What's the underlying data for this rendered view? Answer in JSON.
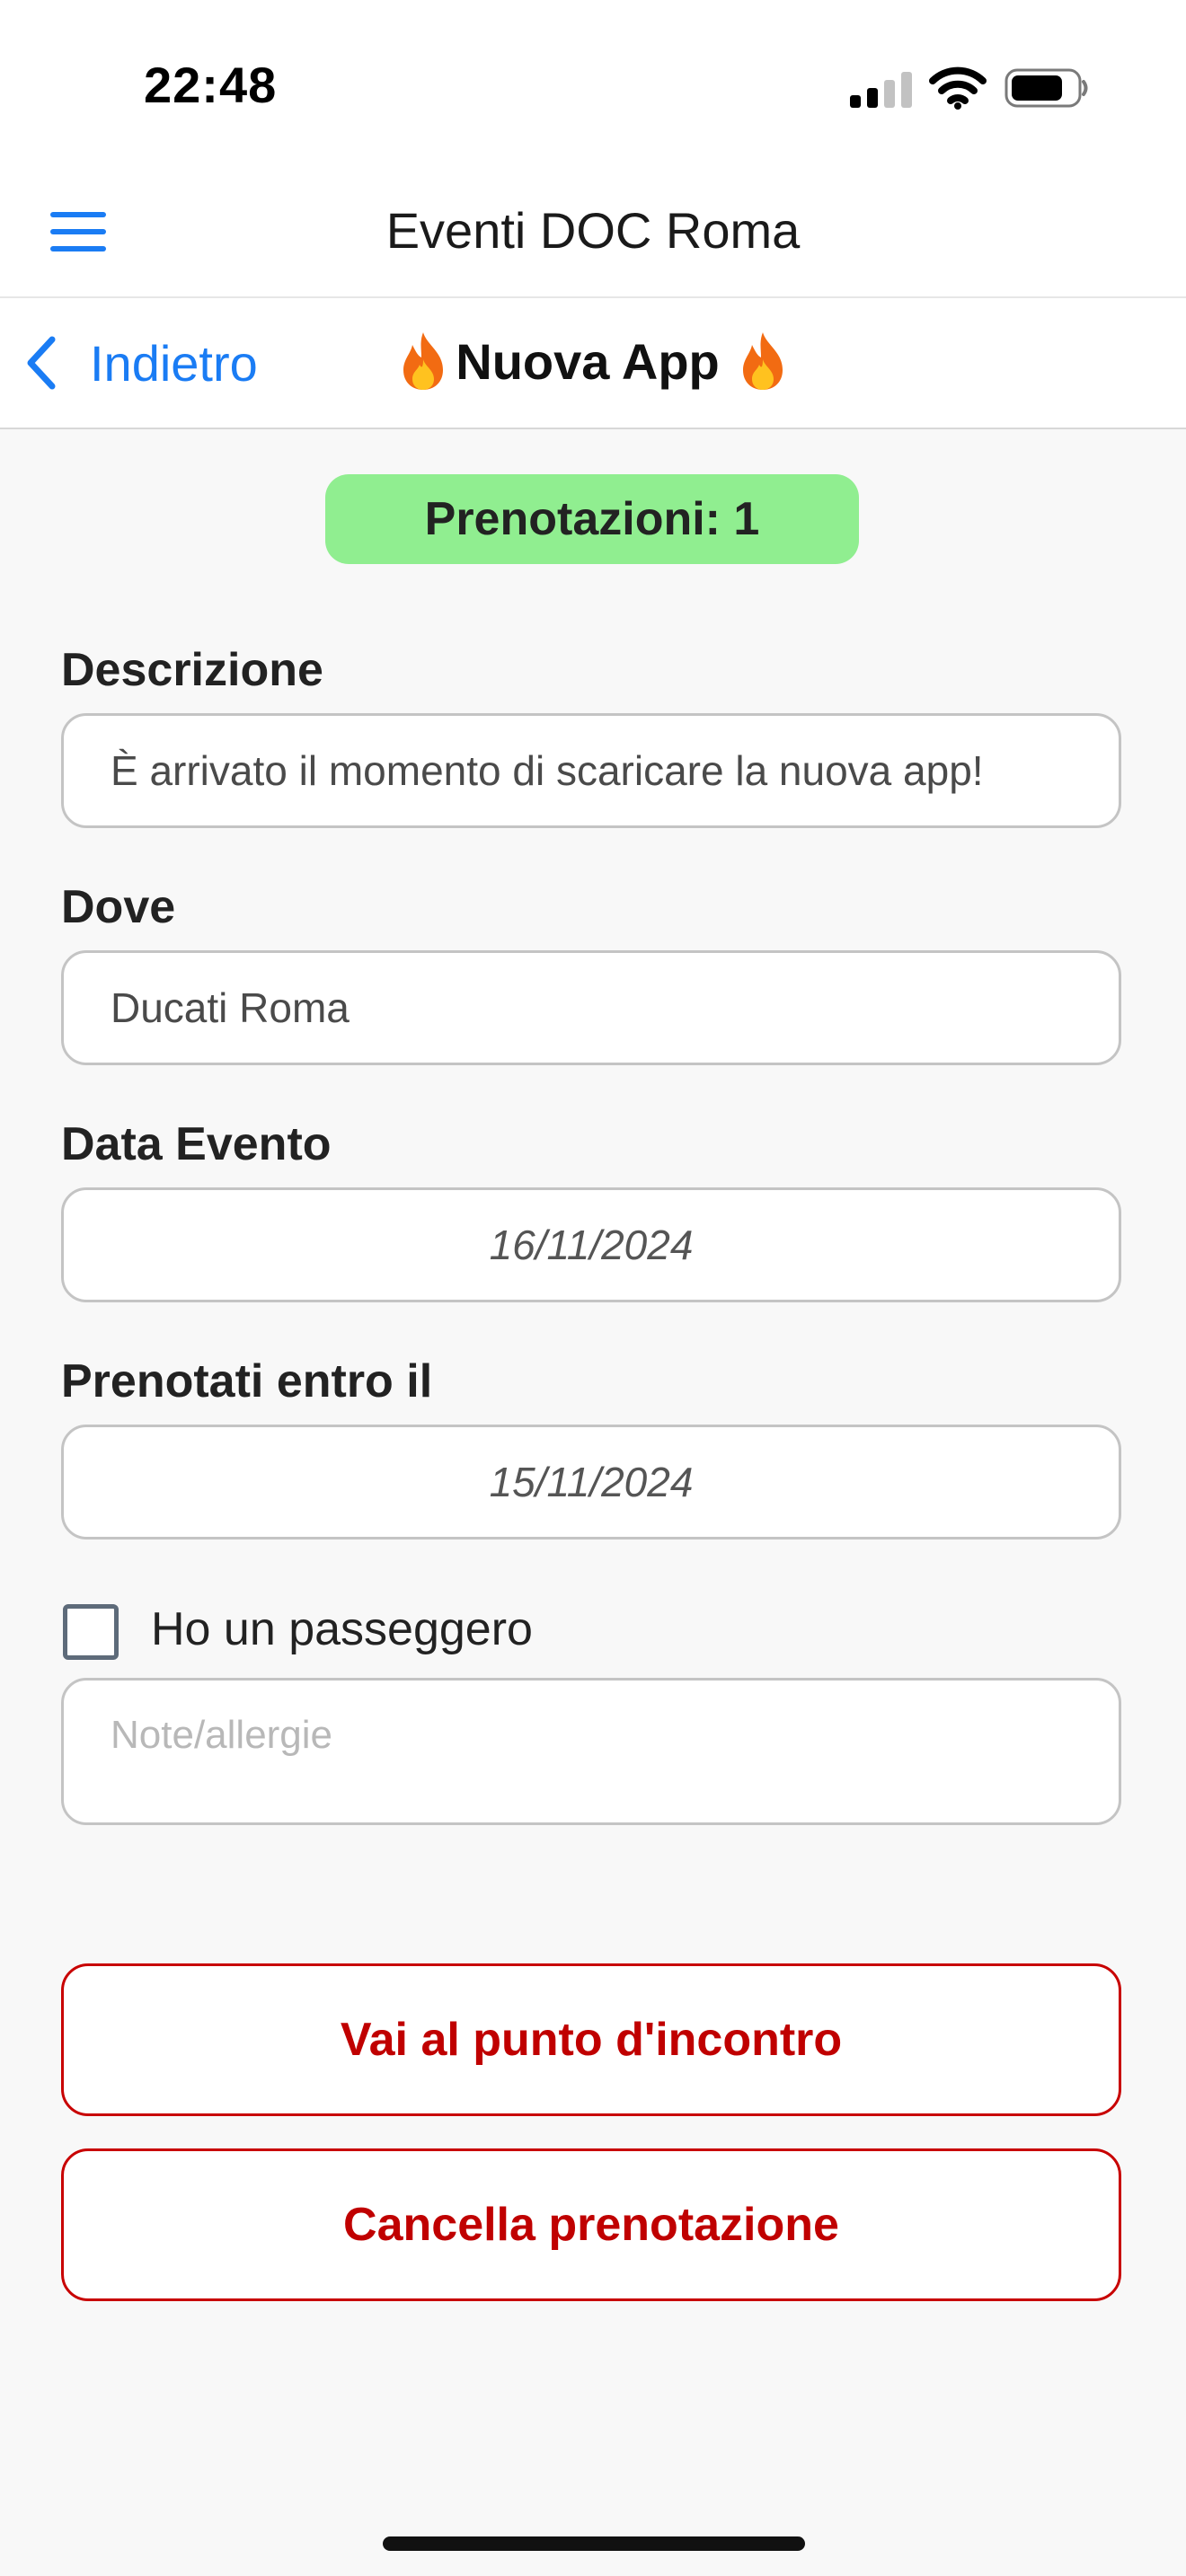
{
  "status_bar": {
    "time": "22:48"
  },
  "header": {
    "title": "Eventi DOC Roma"
  },
  "nav": {
    "back_label": "Indietro",
    "title": "Nuova App"
  },
  "badge": {
    "text": "Prenotazioni: 1",
    "color": "#90ee90"
  },
  "form": {
    "description": {
      "label": "Descrizione",
      "value": "È arrivato il momento di scaricare la nuova app!"
    },
    "location": {
      "label": "Dove",
      "value": "Ducati Roma"
    },
    "event_date": {
      "label": "Data Evento",
      "value": "16/11/2024"
    },
    "deadline": {
      "label": "Prenotati entro il",
      "value": "15/11/2024"
    },
    "passenger": {
      "label": "Ho un passeggero",
      "checked": false
    },
    "notes": {
      "placeholder": "Note/allergie",
      "value": ""
    }
  },
  "actions": {
    "meeting_point_label": "Vai al punto d'incontro",
    "cancel_label": "Cancella prenotazione"
  },
  "icons": {
    "menu": "hamburger-menu-icon",
    "back": "chevron-left-icon",
    "title_decoration": "fire-icon",
    "signal": "cellular-signal-icon",
    "wifi": "wifi-icon",
    "battery": "battery-icon"
  },
  "colors": {
    "accent_blue": "#1a7cf4",
    "danger_red": "#c80000",
    "badge_green": "#90ee90"
  }
}
